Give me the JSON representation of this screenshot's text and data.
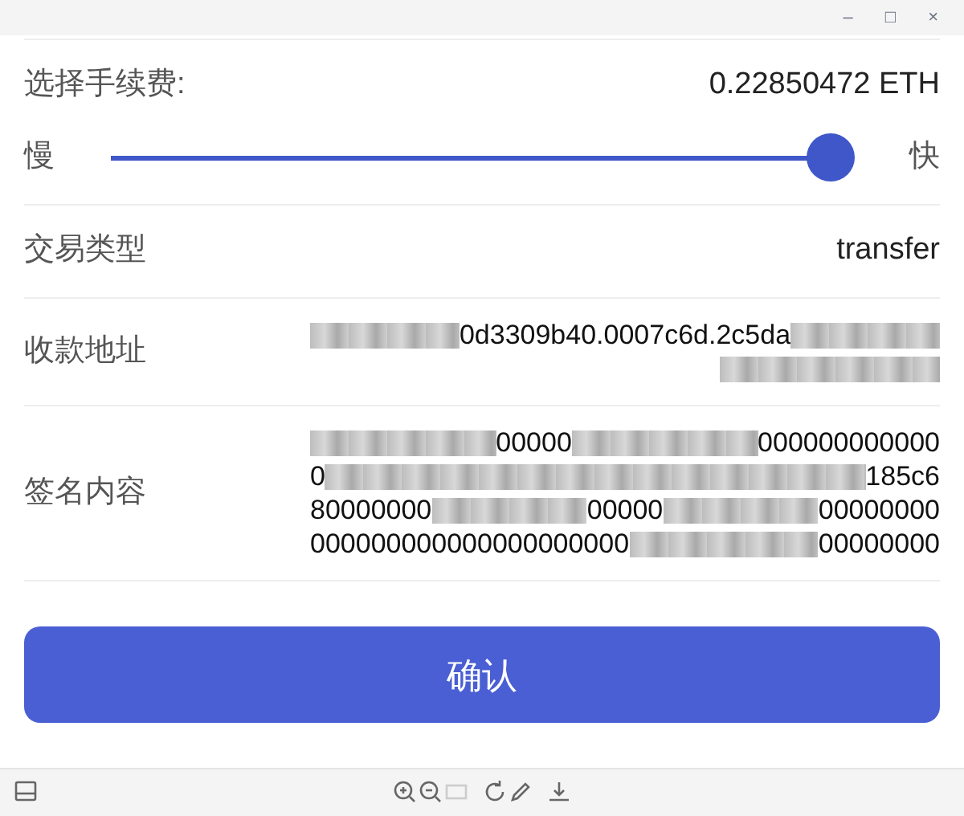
{
  "window": {
    "controls": [
      "–",
      "□",
      "×"
    ]
  },
  "fee": {
    "label": "选择手续费:",
    "value": "0.22850472 ETH",
    "slow": "慢",
    "fast": "快",
    "level": 0.97
  },
  "rows": [
    {
      "kind": "text",
      "label": "交易类型",
      "value": "transfer"
    },
    {
      "kind": "segments",
      "label": "收款地址",
      "lines": [
        [
          {
            "kind": "redacted"
          },
          {
            "kind": "text",
            "text": "0d3309b40.0007c6d.2c5da"
          },
          {
            "kind": "redacted"
          }
        ],
        [
          {
            "kind": "redacted"
          }
        ]
      ]
    },
    {
      "kind": "segments",
      "label": "签名内容",
      "lines": [
        [
          {
            "kind": "redacted"
          },
          {
            "kind": "text",
            "text": "00000"
          },
          {
            "kind": "redacted"
          },
          {
            "kind": "text",
            "text": "000000000000"
          }
        ],
        [
          {
            "kind": "text",
            "text": "0"
          },
          {
            "kind": "redacted"
          },
          {
            "kind": "text",
            "text": "185c6"
          }
        ],
        [
          {
            "kind": "text",
            "text": "80000000"
          },
          {
            "kind": "redacted"
          },
          {
            "kind": "text",
            "text": "00000"
          },
          {
            "kind": "redacted"
          },
          {
            "kind": "text",
            "text": "00000000"
          }
        ],
        [
          {
            "kind": "text",
            "text": "000000000000000000000"
          },
          {
            "kind": "redacted"
          },
          {
            "kind": "text",
            "text": "00000000"
          }
        ]
      ]
    }
  ],
  "confirm": "确认"
}
